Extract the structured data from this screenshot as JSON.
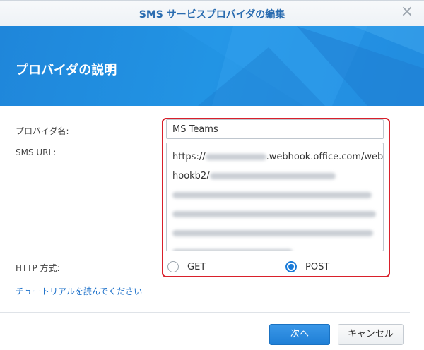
{
  "dialog": {
    "title": "SMS サービスプロバイダの編集",
    "close_glyph": "×",
    "banner_heading": "プロバイダの説明"
  },
  "form": {
    "provider_name_label": "プロバイダ名:",
    "provider_name_value": "MS Teams",
    "sms_url_label": "SMS URL:",
    "sms_url_line1_prefix": "https://",
    "sms_url_line1_suffix": ".webhook.office.com/web",
    "sms_url_line2_prefix": "hookb2/",
    "http_method_label": "HTTP 方式:",
    "methods": [
      {
        "label": "GET",
        "selected": false
      },
      {
        "label": "POST",
        "selected": true
      }
    ]
  },
  "tutorial_link": "チュートリアルを読んでください",
  "buttons": {
    "next_label": "次へ",
    "cancel_label": "キャンセル"
  },
  "colors": {
    "accent": "#1a7bd8",
    "title_text": "#2a6cb0",
    "highlight_border": "#d9202b",
    "banner": "#2294e4"
  },
  "icons": {
    "close": "close-icon"
  }
}
